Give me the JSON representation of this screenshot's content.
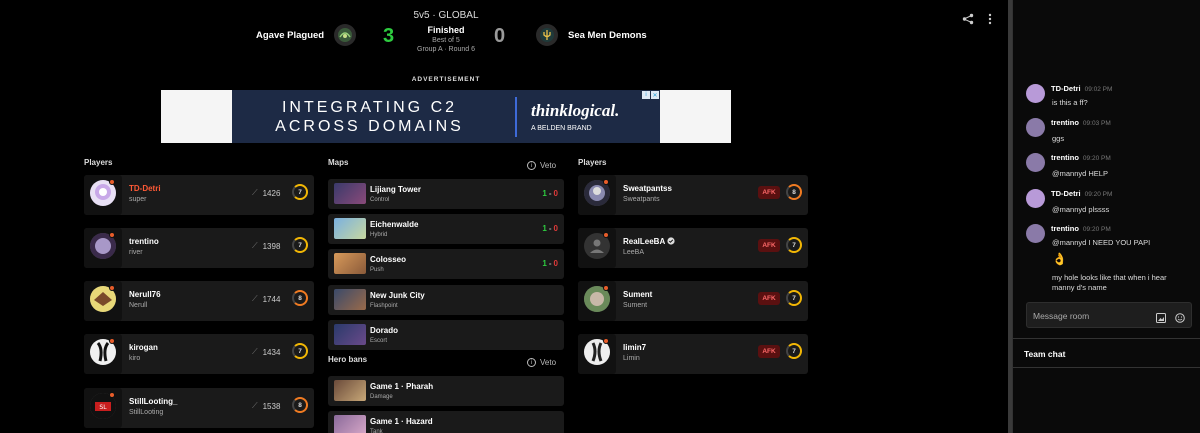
{
  "match": {
    "format": "5v5 · GLOBAL",
    "status": "Finished",
    "best_of": "Best of 5",
    "group": "Group A · Round 6",
    "team_left": {
      "name": "Agave Plagued",
      "score": "3"
    },
    "team_right": {
      "name": "Sea Men Demons",
      "score": "0"
    }
  },
  "ad": {
    "label": "ADVERTISEMENT",
    "line1": "INTEGRATING C2",
    "line2": "ACROSS DOMAINS",
    "brand": "thinklogical.",
    "brand_sub": "A BELDEN BRAND"
  },
  "left_team": {
    "title": "Players",
    "players": [
      {
        "name": "TD-Detri",
        "sub": "super",
        "elo": "1426",
        "level": "7"
      },
      {
        "name": "trentino",
        "sub": "river",
        "elo": "1398",
        "level": "7"
      },
      {
        "name": "Nerull76",
        "sub": "Nerull",
        "elo": "1744",
        "level": "8"
      },
      {
        "name": "kirogan",
        "sub": "kiro",
        "elo": "1434",
        "level": "7"
      },
      {
        "name": "StillLooting_",
        "sub": "StillLooting",
        "elo": "1538",
        "level": "8"
      }
    ]
  },
  "maps": {
    "title": "Maps",
    "veto_label": "Veto",
    "items": [
      {
        "name": "Lijiang Tower",
        "mode": "Control",
        "score_w": "1",
        "score_l": "0"
      },
      {
        "name": "Eichenwalde",
        "mode": "Hybrid",
        "score_w": "1",
        "score_l": "0"
      },
      {
        "name": "Colosseo",
        "mode": "Push",
        "score_w": "1",
        "score_l": "0"
      },
      {
        "name": "New Junk City",
        "mode": "Flashpoint"
      },
      {
        "name": "Dorado",
        "mode": "Escort"
      }
    ]
  },
  "hero_bans": {
    "title": "Hero bans",
    "veto_label": "Veto",
    "items": [
      {
        "name": "Game 1 · Pharah",
        "role": "Damage"
      },
      {
        "name": "Game 1 · Hazard",
        "role": "Tank"
      }
    ]
  },
  "right_team": {
    "title": "Players",
    "afk_label": "AFK",
    "players": [
      {
        "name": "Sweatpantss",
        "sub": "Sweatpants",
        "level": "8"
      },
      {
        "name": "RealLeeBA",
        "sub": "LeeBA",
        "level": "7"
      },
      {
        "name": "Sument",
        "sub": "Sument",
        "level": "7"
      },
      {
        "name": "limin7",
        "sub": "Limin",
        "level": "7"
      }
    ]
  },
  "chat": {
    "messages": [
      {
        "user": "TD-Detri",
        "time": "09:02 PM",
        "lines": [
          "is this a ff?"
        ]
      },
      {
        "user": "trentino",
        "time": "09:03 PM",
        "lines": [
          "ggs"
        ]
      },
      {
        "user": "trentino",
        "time": "09:20 PM",
        "lines": [
          "@mannyd HELP"
        ]
      },
      {
        "user": "TD-Detri",
        "time": "09:20 PM",
        "lines": [
          "@mannyd plssss"
        ]
      },
      {
        "user": "trentino",
        "time": "09:20 PM",
        "lines": [
          "@mannyd I NEED YOU PAPI",
          "👌",
          "my hole looks like that when i hear",
          "manny d's name"
        ]
      }
    ],
    "input_placeholder": "Message room",
    "team_chat_label": "Team chat"
  },
  "colors": {
    "win": "#2ecc40",
    "loss": "#e03a3a",
    "highlight": "#ff5a36",
    "level_yellow": "#f2b705",
    "level_orange": "#f07b22",
    "afk_bg": "#5a1010"
  }
}
